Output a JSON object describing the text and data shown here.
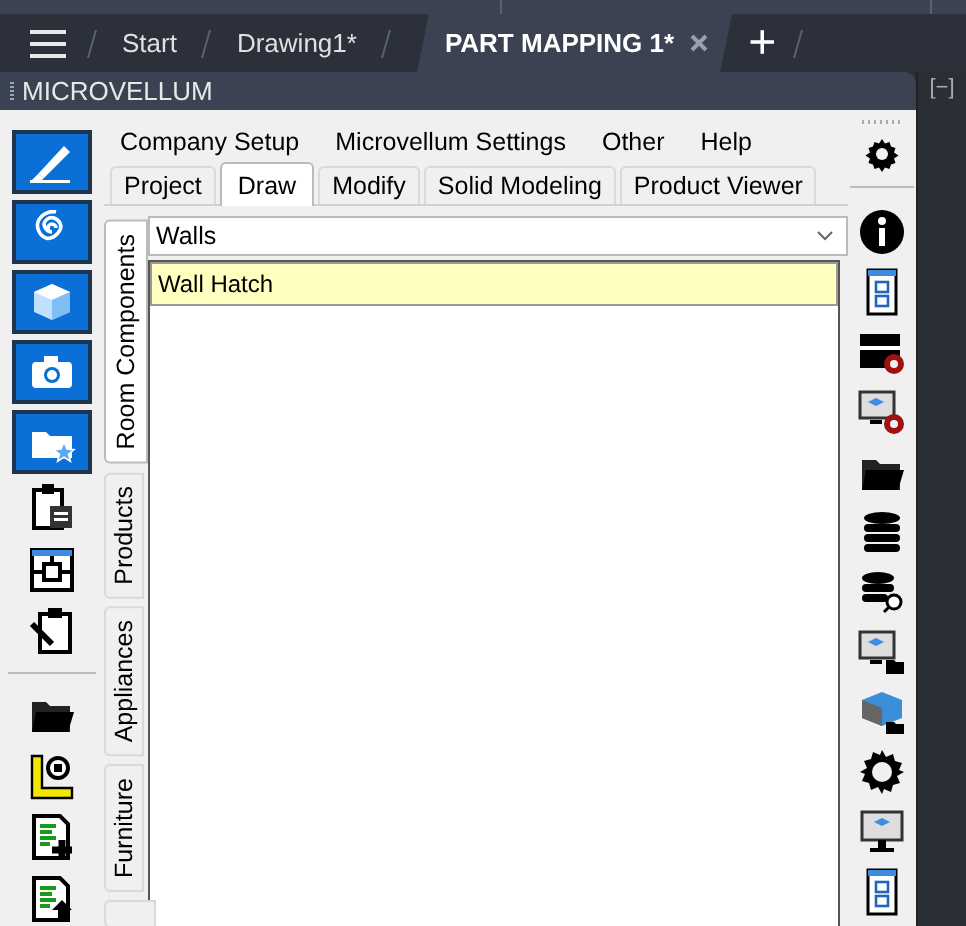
{
  "document_tabs": [
    {
      "label": "Start",
      "selected": false,
      "closable": false
    },
    {
      "label": "Drawing1*",
      "selected": false,
      "closable": false
    },
    {
      "label": "PART MAPPING 1*",
      "selected": true,
      "closable": true
    }
  ],
  "new_tab": "+",
  "panel": {
    "title": "MICROVELLUM"
  },
  "side_collapse": "[−]",
  "menu": [
    "Company Setup",
    "Microvellum Settings",
    "Other",
    "Help"
  ],
  "tabs": [
    {
      "label": "Project",
      "selected": false
    },
    {
      "label": "Draw",
      "selected": true
    },
    {
      "label": "Modify",
      "selected": false
    },
    {
      "label": "Solid Modeling",
      "selected": false
    },
    {
      "label": "Product Viewer",
      "selected": false
    }
  ],
  "side_tabs": [
    {
      "label": "Room Components",
      "selected": true
    },
    {
      "label": "Products",
      "selected": false
    },
    {
      "label": "Appliances",
      "selected": false
    },
    {
      "label": "Furniture",
      "selected": false
    }
  ],
  "category": {
    "value": "Walls"
  },
  "items": [
    {
      "label": "Wall Hatch",
      "selected": true
    }
  ]
}
